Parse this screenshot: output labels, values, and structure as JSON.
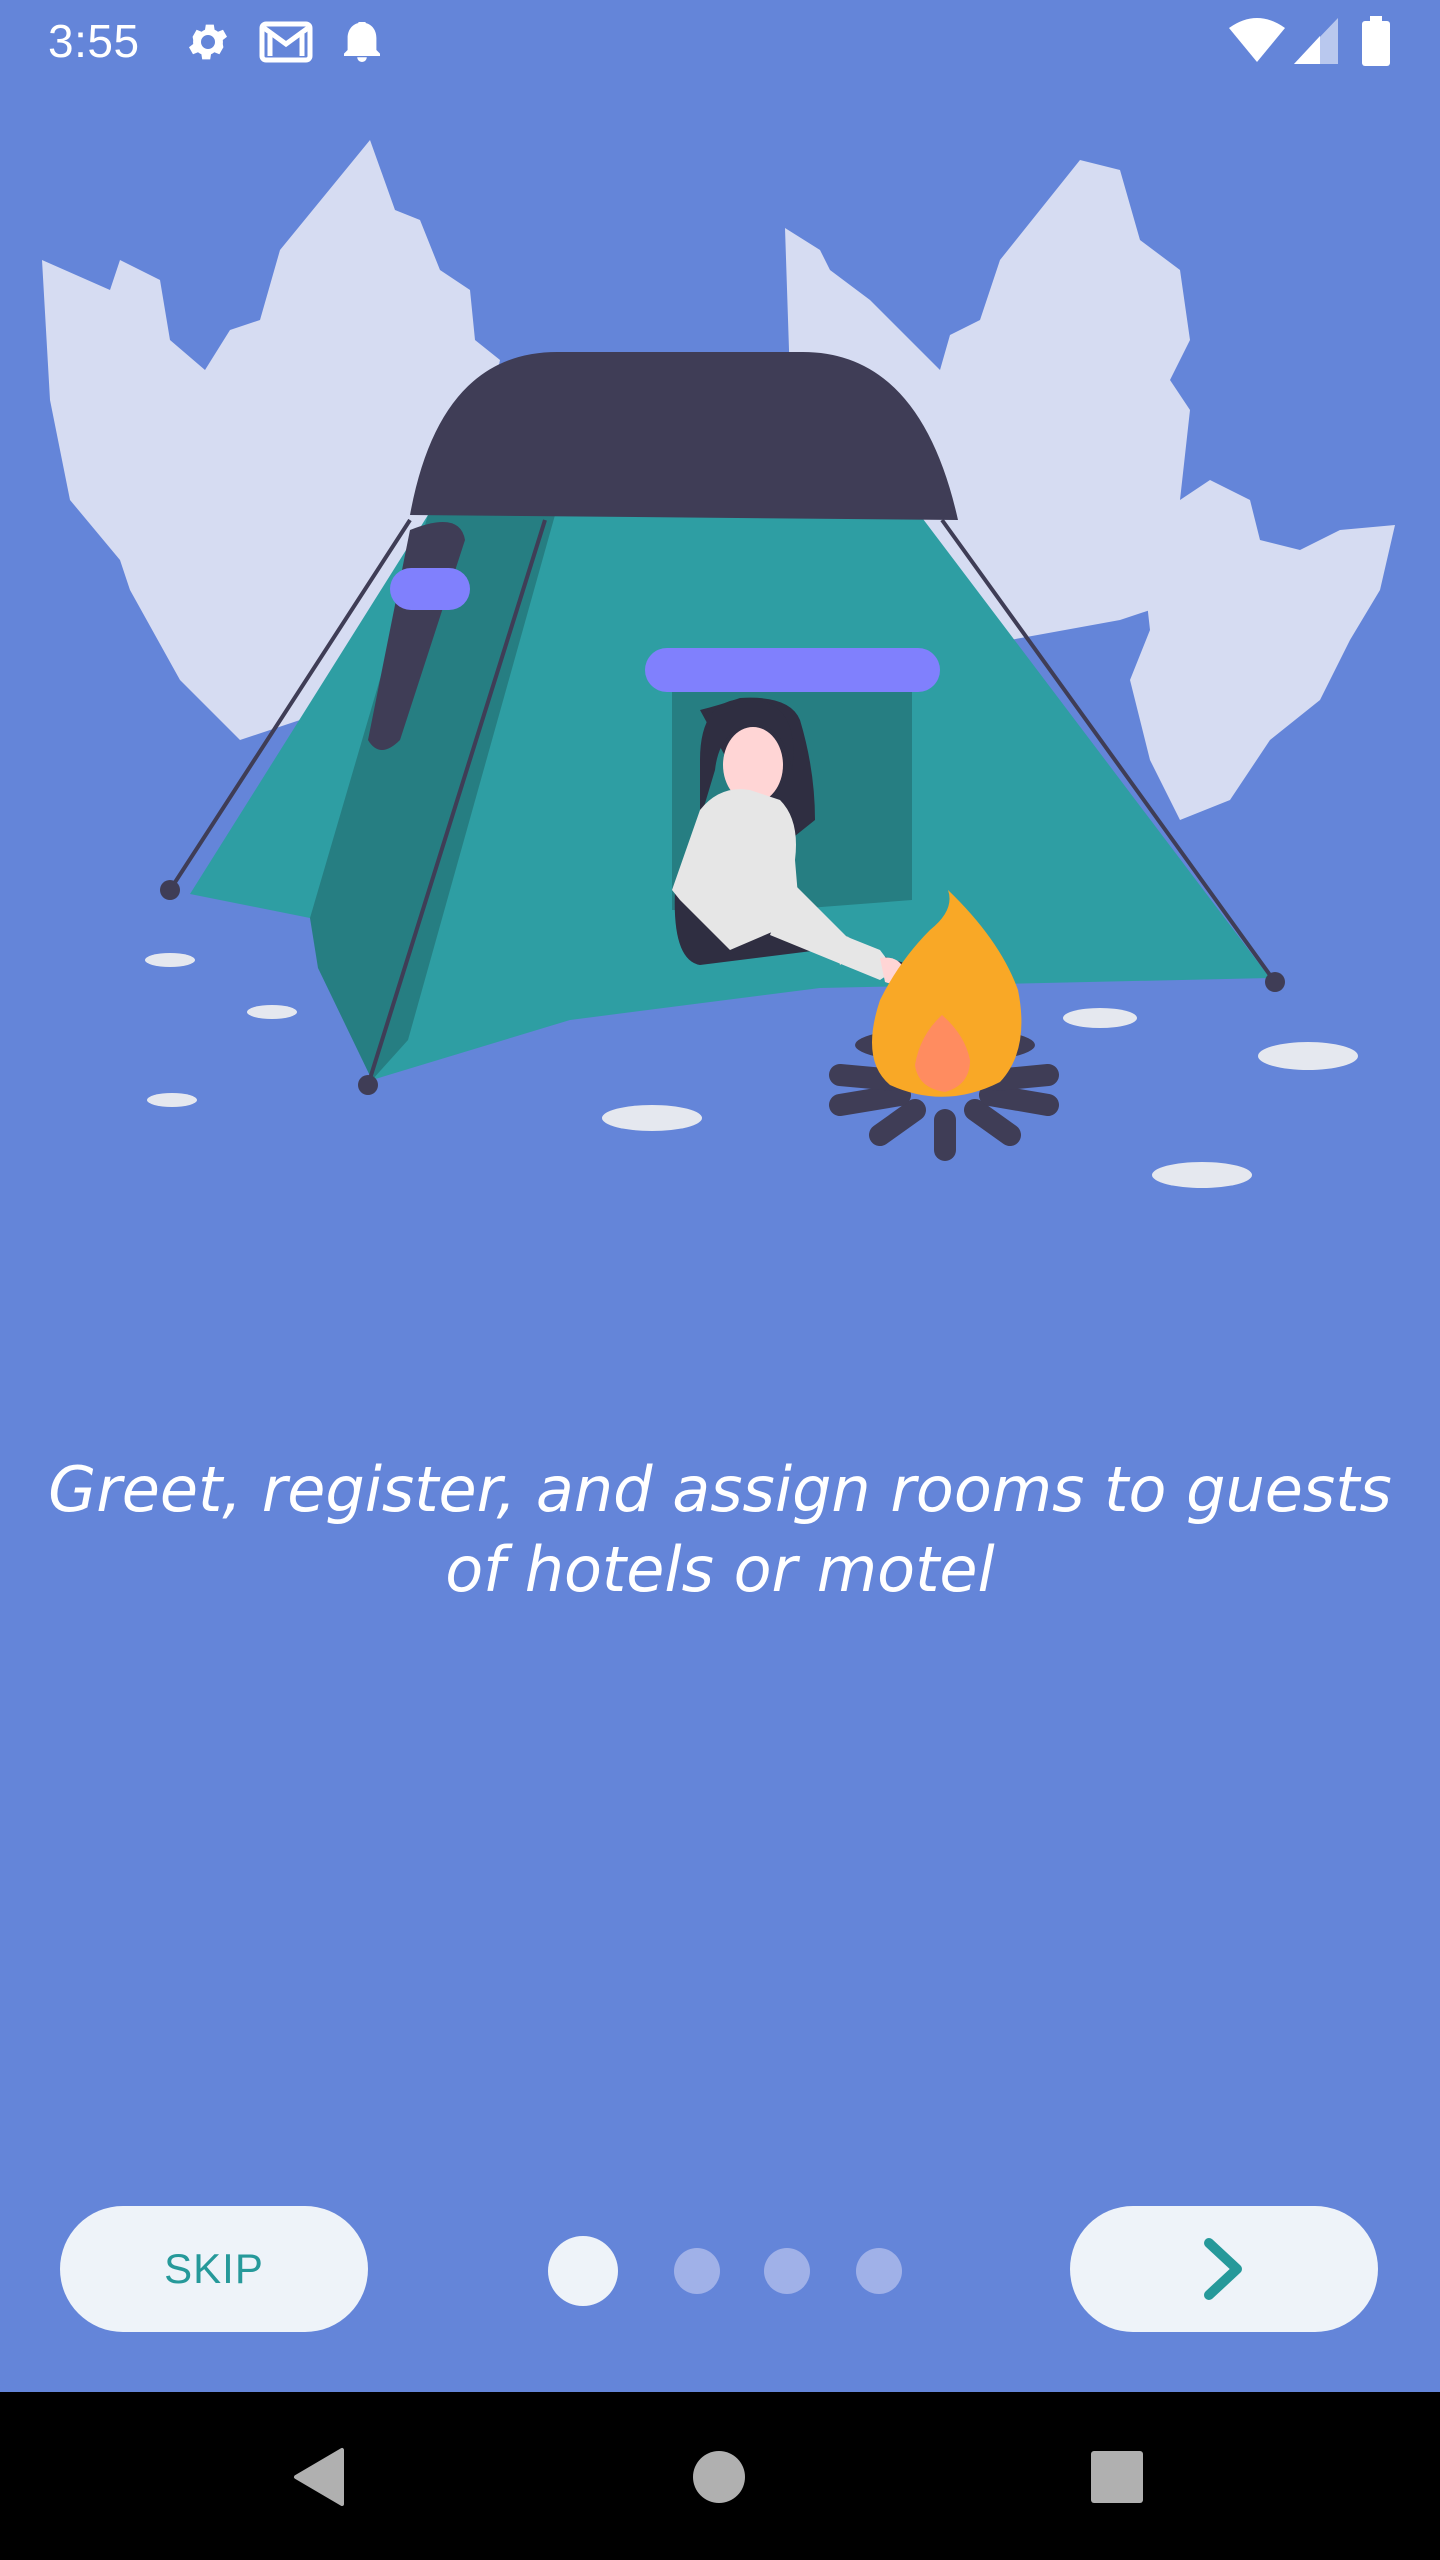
{
  "status_bar": {
    "time": "3:55",
    "left_icons": [
      "settings-icon",
      "gmail-icon",
      "notification-bell-icon"
    ],
    "right_icons": [
      "wifi-icon",
      "cellular-signal-icon",
      "battery-icon"
    ]
  },
  "onboarding": {
    "illustration": "woman-camping-tent-campfire",
    "caption": "Greet, register, and assign rooms to guests of hotels or motel",
    "skip_label": "SKIP",
    "next_icon": "chevron-right-icon",
    "page_indicator": {
      "pages": 4,
      "current": 1
    }
  },
  "nav_bar": {
    "buttons": [
      "back-icon",
      "home-icon",
      "recents-icon"
    ]
  },
  "colors": {
    "background": "#6485d9",
    "button_bg": "#eef3f9",
    "accent_teal": "#26999a",
    "tent_teal": "#2e9ea3",
    "tent_dark": "#3f3d56",
    "flame": "#f9a826",
    "purple": "#8080fd"
  }
}
